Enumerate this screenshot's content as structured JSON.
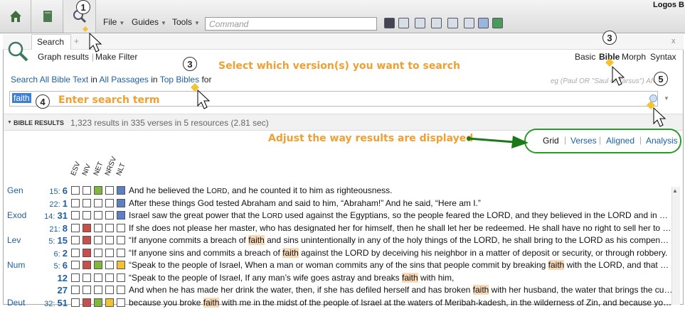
{
  "app": {
    "title": "Logos B"
  },
  "menu": {
    "file": "File",
    "guides": "Guides",
    "tools": "Tools",
    "command_placeholder": "Command"
  },
  "tab": {
    "label": "Search",
    "add": "+"
  },
  "subnav": {
    "grid": "Graph results",
    "filter": "Make Filter"
  },
  "modes": {
    "basic": "Basic",
    "bible": "Bible",
    "morph": "Morph",
    "syntax": "Syntax"
  },
  "query": {
    "search": "Search All Bible Text",
    "in": "in",
    "passages": "All Passages",
    "in2": "in",
    "bibles": "Top Bibles",
    "for": "for"
  },
  "example": "eg (Paul OR \"Saul of Tarsus\") AND",
  "search_term": "faith",
  "results": {
    "title": "BIBLE RESULTS",
    "summary": "1,323 results in 335 verses in 5 resources (2.81 sec)"
  },
  "views": [
    "Grid",
    "Verses",
    "Aligned",
    "Analysis"
  ],
  "annotations": {
    "n1": "1",
    "n3a": "3",
    "n3b": "3",
    "n4": "4",
    "n5": "5",
    "select_version": "Select which version(s) you want to search",
    "enter_term": "Enter search term",
    "adjust": "Adjust the way results are displayed"
  },
  "versions": [
    "ESV",
    "NIV",
    "NET",
    "NRSV",
    "NLT"
  ],
  "colors": {
    "red": "#c9504a",
    "green": "#7fb83a",
    "yellow": "#f2c230",
    "blue": "#5d7fc4",
    "empty": "#ffffff"
  },
  "rows": [
    {
      "book": "Gen",
      "ch": "15:",
      "v": "6",
      "cells": [
        "empty",
        "empty",
        "green",
        "empty",
        "blue"
      ],
      "pre": "And he believed the L",
      "sc": "ORD",
      "post": ", and he counted it to him as righteousness."
    },
    {
      "book": "",
      "ch": "22:",
      "v": "1",
      "cells": [
        "empty",
        "empty",
        "empty",
        "empty",
        "blue"
      ],
      "pre": " After these things God tested Abraham and said to him, “Abraham!” And he said, “Here am I.”",
      "sc": "",
      "post": ""
    },
    {
      "book": "Exod",
      "ch": "14:",
      "v": "31",
      "cells": [
        "empty",
        "empty",
        "empty",
        "empty",
        "blue"
      ],
      "pre": "Israel saw the great power that the L",
      "sc": "ORD",
      "post": " used against the Egyptians, so the people feared the LORD, and they believed in the LORD and in Moses his servant."
    },
    {
      "book": "",
      "ch": "21:",
      "v": "8",
      "cells": [
        "empty",
        "red",
        "empty",
        "empty",
        "empty"
      ],
      "pre": "If she does not please her master, who has designated her for himself, then he shall let her be redeemed. He shall have no right to sell her to a foreign people.",
      "sc": "",
      "post": ""
    },
    {
      "book": "Lev",
      "ch": "5:",
      "v": "15",
      "cells": [
        "empty",
        "red",
        "empty",
        "empty",
        "empty"
      ],
      "pre": "“If anyone commits a breach of ",
      "hl": "faith",
      "post": " and sins unintentionally in any of the holy things of the LORD, he shall bring to the LORD as his compensation a ram."
    },
    {
      "book": "",
      "ch": "6:",
      "v": "2",
      "cells": [
        "empty",
        "red",
        "empty",
        "empty",
        "empty"
      ],
      "pre": "“If anyone sins and commits a breach of ",
      "hl": "faith",
      "post": " against the LORD by deceiving his neighbor in a matter of deposit or security, or through robbery."
    },
    {
      "book": "Num",
      "ch": "5:",
      "v": "6",
      "cells": [
        "empty",
        "red",
        "green",
        "empty",
        "yellow"
      ],
      "pre": "“Speak to the people of Israel, When a man or woman commits any of the sins that people commit by breaking ",
      "hl": "faith",
      "post": " with the LORD, and that person realizes his guilt."
    },
    {
      "book": "",
      "ch": "",
      "v": "12",
      "cells": [
        "empty",
        "empty",
        "empty",
        "empty",
        "empty"
      ],
      "pre": "“Speak to the people of Israel, If any man’s wife goes astray and breaks ",
      "hl": "faith",
      "post": " with him,"
    },
    {
      "book": "",
      "ch": "",
      "v": "27",
      "cells": [
        "empty",
        "empty",
        "empty",
        "empty",
        "empty"
      ],
      "pre": "And when he has made her drink the water, then, if she has defiled herself and has broken ",
      "hl": "faith",
      "post": " with her husband, the water that brings the curse shall enter into her."
    },
    {
      "book": "Deut",
      "ch": "32:",
      "v": "51",
      "cells": [
        "empty",
        "red",
        "green",
        "yellow",
        "empty"
      ],
      "pre": "because you broke ",
      "hl": "faith",
      "post": " with me in the midst of the people of Israel at the waters of Meribah-kadesh, in the wilderness of Zin, and because you did not treat me as holy."
    }
  ]
}
